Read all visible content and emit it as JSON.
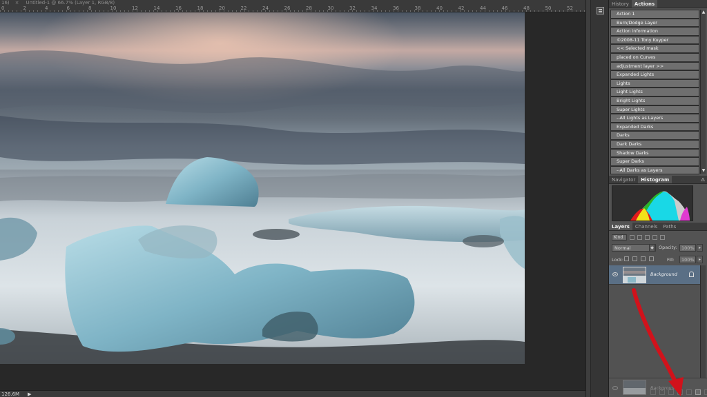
{
  "document": {
    "tab_prefix": "16)",
    "tab_title": "Untitled-1 @ 66.7% (Layer 1, RGB/8)",
    "ruler_labels": [
      "0",
      "2",
      "4",
      "6",
      "8",
      "10",
      "12",
      "14",
      "16",
      "18",
      "20",
      "22",
      "24",
      "26",
      "28",
      "30",
      "32",
      "34",
      "36",
      "38",
      "40",
      "42",
      "44",
      "46",
      "48",
      "50",
      "52"
    ]
  },
  "status": {
    "zoom": "126.6M",
    "arrow": "▶"
  },
  "actions_panel": {
    "tabs": [
      {
        "label": "History",
        "active": false
      },
      {
        "label": "Actions",
        "active": true
      }
    ],
    "items": [
      "Action 1",
      "Burn/Dodge Layer",
      "Action information",
      "©2008-11 Tony Kuyper",
      "<< Selected mask",
      "placed on Curves",
      "adjustment layer >>",
      "Expanded Lights",
      "Lights",
      "Light Lights",
      "Bright Lights",
      "Super Lights",
      "--All Lights as Layers",
      "Expanded Darks",
      "Darks",
      "Dark Darks",
      "Shadow Darks",
      "Super Darks",
      "--All Darks as Layers"
    ]
  },
  "histogram_panel": {
    "tabs": [
      {
        "label": "Navigator",
        "active": false
      },
      {
        "label": "Histogram",
        "active": true
      }
    ],
    "warning": "⚠"
  },
  "layers_panel": {
    "tabs": [
      {
        "label": "Layers",
        "active": true
      },
      {
        "label": "Channels",
        "active": false
      },
      {
        "label": "Paths",
        "active": false
      }
    ],
    "kind_label": "Kind",
    "blend_mode": "Normal",
    "opacity_label": "Opacity:",
    "opacity_value": "100%",
    "lock_label": "Lock:",
    "fill_label": "Fill:",
    "fill_value": "100%",
    "layers": [
      {
        "name": "Background"
      }
    ],
    "drag_ghost_name": "Background"
  },
  "colors": {
    "selected_layer": "#5a6f85",
    "annotation_arrow": "#d1121b",
    "panel_bg": "#535353",
    "action_item_bg": "#6f6f6f"
  }
}
